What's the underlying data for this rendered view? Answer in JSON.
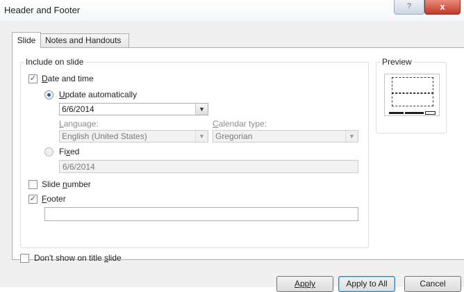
{
  "window": {
    "title": "Header and Footer",
    "help_glyph": "?",
    "close_glyph": "x"
  },
  "tabs": [
    {
      "label": "Slide",
      "active": true
    },
    {
      "label": "Notes and Handouts",
      "active": false
    }
  ],
  "include_group": {
    "label": "Include on slide",
    "date_and_time": {
      "label": "Date and time",
      "checked": true
    },
    "update_automatically": {
      "label": "Update automatically",
      "selected": true,
      "value": "6/6/2014"
    },
    "language": {
      "label": "Language:",
      "value": "English (United States)"
    },
    "calendar_type": {
      "label": "Calendar type:",
      "value": "Gregorian"
    },
    "fixed": {
      "label": "Fixed",
      "selected": false,
      "value": "6/6/2014"
    },
    "slide_number": {
      "label": "Slide number",
      "checked": false
    },
    "footer": {
      "label": "Footer",
      "checked": true,
      "value": ""
    }
  },
  "dont_show_on_title_slide": {
    "label": "Don't show on title slide",
    "checked": false
  },
  "preview": {
    "label": "Preview"
  },
  "buttons": {
    "apply": "Apply",
    "apply_to_all": "Apply to All",
    "cancel": "Cancel"
  },
  "icons": {
    "checkmark": "check-icon",
    "dropdown": "chevron-down-icon"
  },
  "colors": {
    "accent": "#1e5aa8",
    "close_button": "#c23a27"
  }
}
